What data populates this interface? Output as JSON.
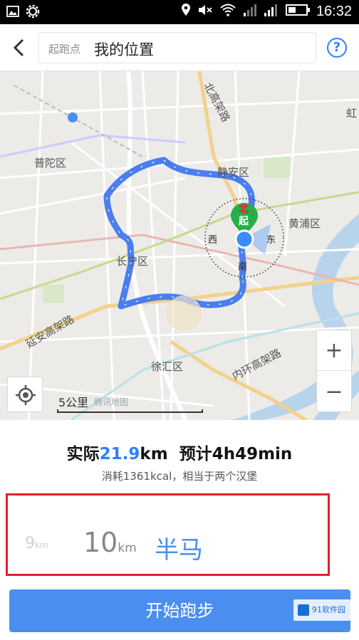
{
  "status_bar": {
    "time": "16:32"
  },
  "header": {
    "start_label": "起跑点",
    "start_value": "我的位置",
    "help_symbol": "?"
  },
  "map": {
    "labels": {
      "putuo": "普陀区",
      "jingan": "静安区",
      "huangpu": "黄浦区",
      "changning": "长宁区",
      "xuhui": "徐汇区",
      "yanan_road": "延安高架路",
      "neihuan_road": "内环高架路",
      "north_road": "北高架路",
      "hong": "虹"
    },
    "compass": {
      "north": "北",
      "east": "东",
      "south": "南",
      "west": "西",
      "start_marker": "起"
    },
    "scale": "5公里",
    "logo": "腾讯地图",
    "zoom_in": "+",
    "zoom_out": "−"
  },
  "stats": {
    "actual_label": "实际",
    "actual_value": "21.9",
    "actual_unit": "km",
    "estimate_label": "预计",
    "estimate_value": "4h49min",
    "calorie_text": "消耗1361kcal，相当于两个汉堡"
  },
  "distance_picker": {
    "options": [
      {
        "value": "9",
        "unit": "km"
      },
      {
        "value": "10",
        "unit": "km"
      },
      {
        "value": "半马",
        "unit": ""
      }
    ],
    "selected": "半马"
  },
  "start_button": {
    "label": "开始跑步"
  },
  "watermark": {
    "text": "91软件园"
  },
  "colors": {
    "accent": "#2c82ff",
    "button": "#4a8ff0",
    "route": "#4a7ef0",
    "highlight_border": "#e0202c"
  }
}
